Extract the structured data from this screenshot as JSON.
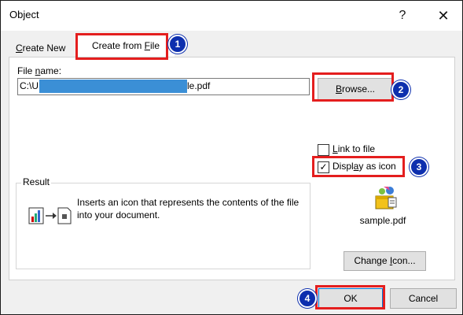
{
  "window": {
    "title": "Object",
    "help_glyph": "?",
    "close_glyph": "✕"
  },
  "tabs": [
    {
      "label_pre": "",
      "label_u": "C",
      "label_post": "reate New"
    },
    {
      "label_pre": "Create from ",
      "label_u": "F",
      "label_post": "ile"
    }
  ],
  "file_name": {
    "label_pre": "File ",
    "label_u": "n",
    "label_post": "ame:",
    "value_prefix": "C:\\U",
    "value_suffix": "le.pdf"
  },
  "browse": {
    "label_pre": "",
    "label_u": "B",
    "label_post": "rowse..."
  },
  "checkboxes": {
    "link": {
      "label_pre": "",
      "label_u": "L",
      "label_post": "ink to file",
      "checked": false
    },
    "display": {
      "label_pre": "Displ",
      "label_u": "a",
      "label_post": "y as icon",
      "checked": true,
      "check_glyph": "✓"
    }
  },
  "result": {
    "legend": "Result",
    "text": "Inserts an icon that represents the contents of the file into your document."
  },
  "icon_preview": {
    "file_name": "sample.pdf"
  },
  "change_icon": {
    "label_pre": "Change ",
    "label_u": "I",
    "label_post": "con..."
  },
  "buttons": {
    "ok": "OK",
    "cancel": "Cancel"
  },
  "annotations": {
    "step1": "1",
    "step2": "2",
    "step3": "3",
    "step4": "4",
    "highlight_color": "#e41e1e",
    "badge_color": "#0d2fae"
  }
}
